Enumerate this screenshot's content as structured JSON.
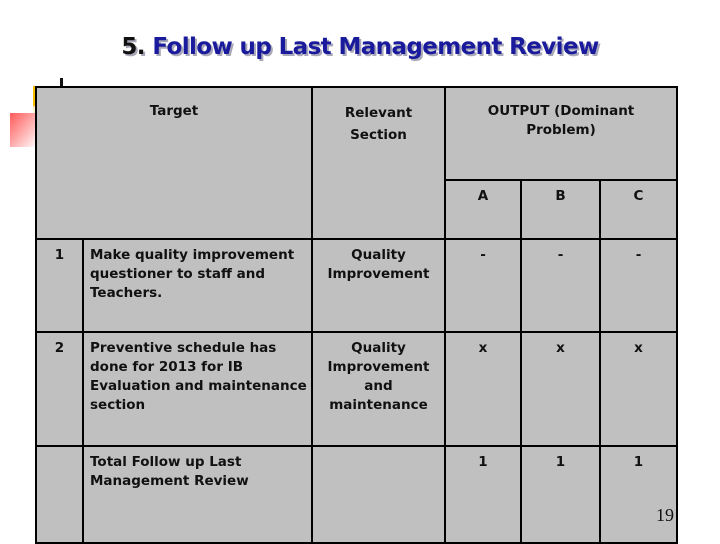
{
  "slide": {
    "title_number": "5.",
    "title_text": "Follow up Last Management Review",
    "page_number": "19"
  },
  "table": {
    "headers": {
      "target": "Target",
      "relevant_section": "Relevant Section",
      "output": "OUTPUT (Dominant Problem)",
      "sub_columns": [
        "A",
        "B",
        "C"
      ]
    },
    "rows": [
      {
        "index": "1",
        "target": "Make quality improvement questioner to staff and Teachers.",
        "relevant_section": "Quality Improvement",
        "a": "-",
        "b": "-",
        "c": "-"
      },
      {
        "index": "2",
        "target": "Preventive schedule has done for 2013 for IB Evaluation and maintenance section",
        "relevant_section": "Quality Improvement and maintenance",
        "a": "x",
        "b": "x",
        "c": "x"
      }
    ],
    "total": {
      "index": "",
      "label": "Total Follow up Last Management Review",
      "relevant_section": "",
      "a": "1",
      "b": "1",
      "c": "1"
    }
  },
  "colors": {
    "title": "#1a1a9c",
    "table_fill": "#c0c0c0",
    "border": "#000000",
    "accent_yellow": "#f6c000",
    "accent_red": "#ff5a5a"
  }
}
